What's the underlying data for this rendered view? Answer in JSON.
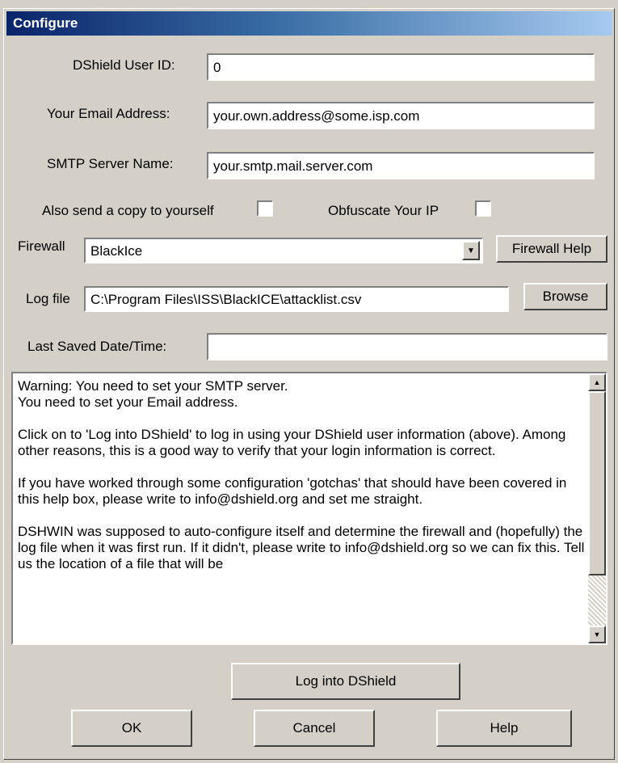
{
  "window": {
    "title": "Configure"
  },
  "fields": {
    "user_id": {
      "label": "DShield User ID:",
      "value": "0"
    },
    "email": {
      "label": "Your Email Address:",
      "value": "your.own.address@some.isp.com"
    },
    "smtp": {
      "label": "SMTP Server Name:",
      "value": "your.smtp.mail.server.com"
    },
    "send_copy": {
      "label": "Also send a copy to yourself",
      "checked": false
    },
    "obfuscate": {
      "label": "Obfuscate Your IP",
      "checked": false
    },
    "firewall": {
      "label": "Firewall",
      "selected": "BlackIce"
    },
    "logfile": {
      "label": "Log file",
      "value": "C:\\Program Files\\ISS\\BlackICE\\attacklist.csv"
    },
    "last_saved": {
      "label": "Last Saved Date/Time:",
      "value": ""
    }
  },
  "buttons": {
    "firewall_help": "Firewall Help",
    "browse": "Browse",
    "login": "Log into DShield",
    "ok": "OK",
    "cancel": "Cancel",
    "help": "Help"
  },
  "messages": [
    "Warning: You need to set your SMTP server.\nYou need to set your Email address.",
    "Click on to 'Log into DShield' to log in using your DShield user information (above). Among other reasons, this is a good way to verify that your login information is correct.",
    "If you have worked through some configuration 'gotchas' that should have been covered in this help box, please write to info@dshield.org and set me straight.",
    "DSHWIN was supposed to auto-configure itself and determine the firewall and (hopefully) the log file when it was first run. If it didn't, please write to info@dshield.org so we can fix this. Tell us the location of a file that will be"
  ],
  "icons": {
    "combo_arrow": "chevron-down-icon",
    "scroll_up": "arrow-up-icon",
    "scroll_down": "arrow-down-icon"
  }
}
